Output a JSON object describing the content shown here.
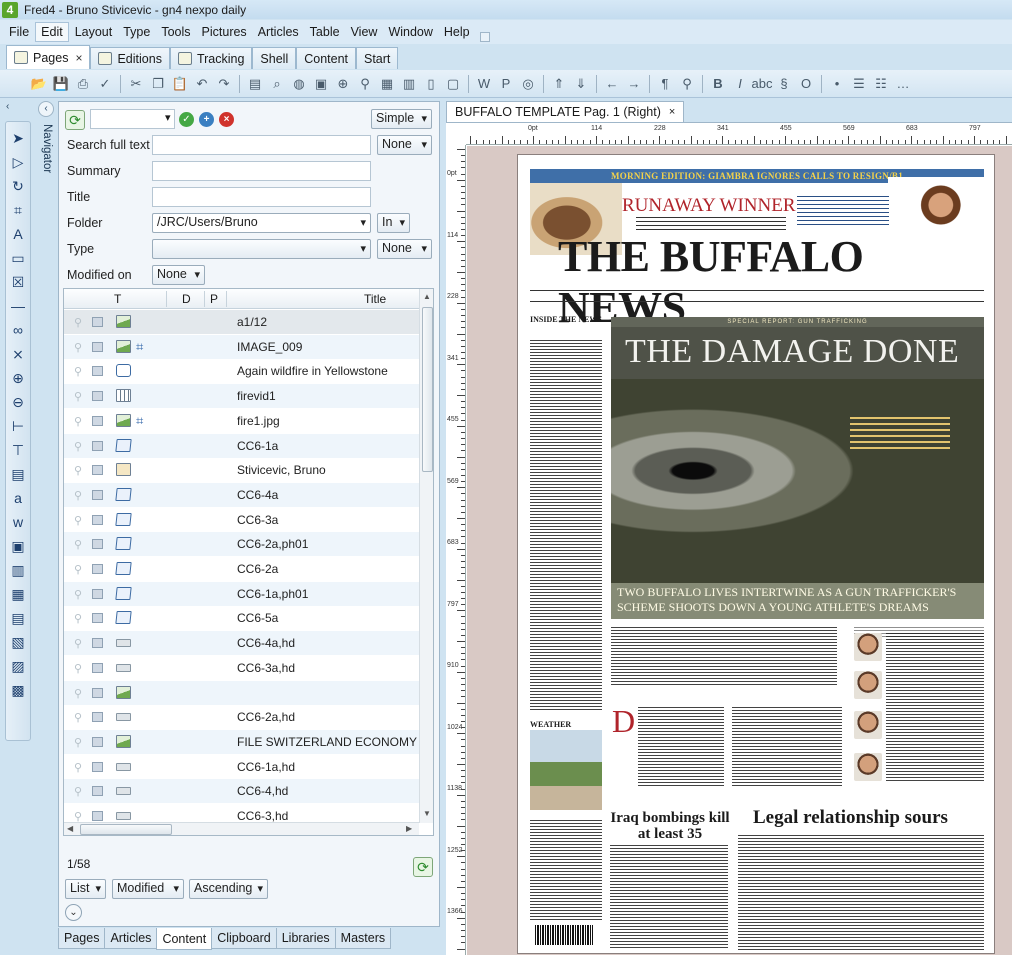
{
  "window": {
    "title": "Fred4 - Bruno Stivicevic - gn4 nexpo daily",
    "app_icon_letter": "4"
  },
  "menubar": {
    "items": [
      "File",
      "Edit",
      "Layout",
      "Type",
      "Tools",
      "Pictures",
      "Articles",
      "Table",
      "View",
      "Window",
      "Help"
    ]
  },
  "tabs": [
    {
      "label": "Pages",
      "active": true,
      "closable": true
    },
    {
      "label": "Editions"
    },
    {
      "label": "Tracking"
    },
    {
      "label": "Shell"
    },
    {
      "label": "Content"
    },
    {
      "label": "Start"
    }
  ],
  "navigator": {
    "label": "Navigator"
  },
  "search": {
    "view_mode": "Simple",
    "fields": {
      "search_full_text": {
        "label": "Search full text",
        "value": "",
        "option": "None"
      },
      "summary": {
        "label": "Summary",
        "value": ""
      },
      "title": {
        "label": "Title",
        "value": ""
      },
      "folder": {
        "label": "Folder",
        "value": "/JRC/Users/Bruno",
        "option": "In"
      },
      "type": {
        "label": "Type",
        "value": "",
        "option": "None"
      },
      "modified_on": {
        "label": "Modified on",
        "option": "None"
      }
    }
  },
  "grid": {
    "columns": [
      "T",
      "D",
      "P",
      "Title"
    ],
    "rows": [
      {
        "type": "image",
        "crop": false,
        "title": "a1/12",
        "selected": true
      },
      {
        "type": "image",
        "crop": true,
        "title": "IMAGE_009"
      },
      {
        "type": "plug",
        "crop": false,
        "title": "Again wildfire in Yellowstone"
      },
      {
        "type": "video",
        "crop": false,
        "title": "firevid1"
      },
      {
        "type": "image",
        "crop": true,
        "title": "fire1.jpg"
      },
      {
        "type": "text",
        "crop": false,
        "title": "CC6-1a"
      },
      {
        "type": "person",
        "crop": false,
        "title": "Stivicevic, Bruno"
      },
      {
        "type": "text",
        "crop": false,
        "title": "CC6-4a"
      },
      {
        "type": "text",
        "crop": false,
        "title": "CC6-3a"
      },
      {
        "type": "text",
        "crop": false,
        "title": "CC6-2a,ph01"
      },
      {
        "type": "text",
        "crop": false,
        "title": "CC6-2a"
      },
      {
        "type": "text",
        "crop": false,
        "title": "CC6-1a,ph01"
      },
      {
        "type": "text",
        "crop": false,
        "title": "CC6-5a"
      },
      {
        "type": "hd",
        "crop": false,
        "title": "CC6-4a,hd"
      },
      {
        "type": "hd",
        "crop": false,
        "title": "CC6-3a,hd"
      },
      {
        "type": "image",
        "crop": false,
        "title": ""
      },
      {
        "type": "hd",
        "crop": false,
        "title": "CC6-2a,hd"
      },
      {
        "type": "image",
        "crop": false,
        "title": "FILE SWITZERLAND ECONOMY CL"
      },
      {
        "type": "hd",
        "crop": false,
        "title": "CC6-1a,hd"
      },
      {
        "type": "hd",
        "crop": false,
        "title": "CC6-4,hd"
      },
      {
        "type": "hd",
        "crop": false,
        "title": "CC6-3,hd"
      },
      {
        "type": "hd",
        "crop": false,
        "title": "CC6-2,hd"
      }
    ]
  },
  "result_count": "1/58",
  "list_options": {
    "view": "List",
    "sort_field": "Modified",
    "sort_order": "Ascending"
  },
  "panel_tabs": [
    {
      "label": "Pages"
    },
    {
      "label": "Articles"
    },
    {
      "label": "Content",
      "active": true
    },
    {
      "label": "Clipboard"
    },
    {
      "label": "Libraries"
    },
    {
      "label": "Masters"
    }
  ],
  "document": {
    "tab_label": "BUFFALO TEMPLATE Pag. 1  (Right)",
    "ruler_h": [
      "0pt",
      "114",
      "228",
      "341",
      "455",
      "569",
      "683",
      "797"
    ],
    "ruler_v": [
      "0pt",
      "114",
      "228",
      "341",
      "455",
      "569",
      "683",
      "797",
      "910",
      "1024",
      "1138",
      "1252",
      "1366"
    ]
  },
  "newspaper": {
    "banner": "MORNING EDITION: GIAMBRA IGNORES CALLS TO RESIGN/B1",
    "runaway": "RUNAWAY WINNER",
    "masthead": "THE BUFFALO NEWS",
    "inside": "INSIDE THE NEWS",
    "special": "SPECIAL REPORT: GUN TRAFFICKING",
    "headline": "THE DAMAGE DONE",
    "gun_deck": "TWO BUFFALO LIVES INTERTWINE AS A GUN TRAFFICKER'S SCHEME SHOOTS DOWN A YOUNG ATHLETE'S DREAMS",
    "weather": "WEATHER",
    "iraq": "Iraq bombings kill at least 35",
    "legal": "Legal relationship sours",
    "dropcap": "D"
  },
  "colors": {
    "accent_blue": "#3f6fa8",
    "masthead_red": "#b0242b",
    "chrome": "#cfe3f1"
  }
}
